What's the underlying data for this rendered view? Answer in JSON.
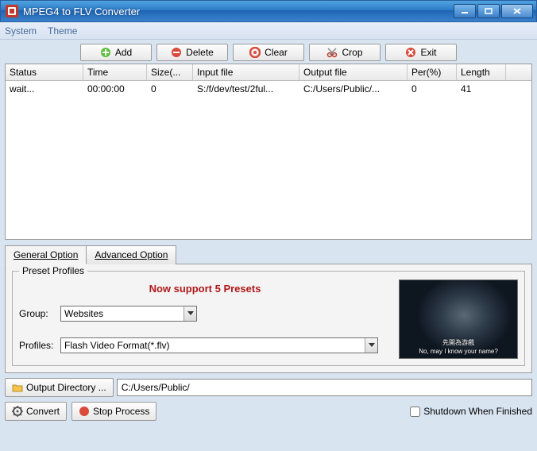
{
  "window": {
    "title": "MPEG4 to FLV Converter"
  },
  "menu": {
    "system": "System",
    "theme": "Theme"
  },
  "toolbar": {
    "add": "Add",
    "delete": "Delete",
    "clear": "Clear",
    "crop": "Crop",
    "exit": "Exit"
  },
  "table": {
    "headers": [
      "Status",
      "Time",
      "Size(...",
      "Input file",
      "Output file",
      "Per(%)",
      "Length"
    ],
    "rows": [
      {
        "status": "wait...",
        "time": "00:00:00",
        "size": "0",
        "input": "S:/f/dev/test/2ful...",
        "output": "C:/Users/Public/...",
        "per": "0",
        "length": "41"
      }
    ]
  },
  "tabs": {
    "general": "General Option",
    "advanced": "Advanced Option"
  },
  "preset": {
    "legend": "Preset Profiles",
    "message": "Now support 5 Presets",
    "group_label": "Group:",
    "group_value": "Websites",
    "profiles_label": "Profiles:",
    "profiles_value": "Flash Video Format(*.flv)",
    "thumb_sub1": "先開為游戲",
    "thumb_sub2": "No, may I know your name?"
  },
  "output": {
    "button": "Output Directory ...",
    "path": "C:/Users/Public/"
  },
  "bottom": {
    "convert": "Convert",
    "stop": "Stop Process",
    "shutdown": "Shutdown When Finished"
  }
}
